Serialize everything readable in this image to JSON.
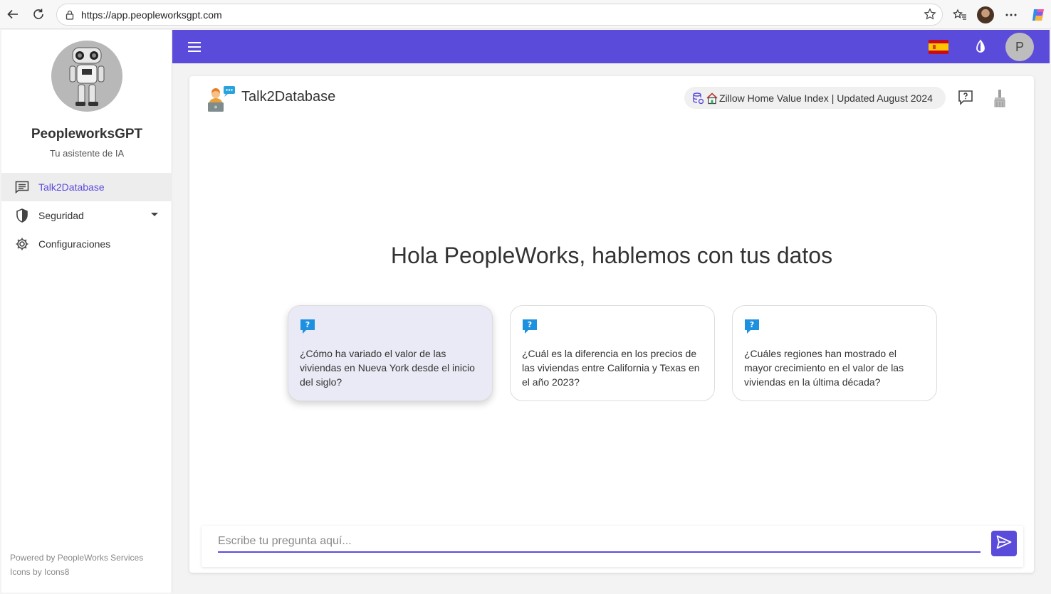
{
  "browser": {
    "url": "https://app.peopleworksgpt.com"
  },
  "sidebar": {
    "app_name": "PeopleworksGPT",
    "subtitle": "Tu asistente de IA",
    "items": [
      {
        "label": "Talk2Database",
        "icon": "chat-icon",
        "active": true
      },
      {
        "label": "Seguridad",
        "icon": "shield-icon",
        "active": false
      },
      {
        "label": "Configuraciones",
        "icon": "gear-icon",
        "active": false
      }
    ],
    "footer": {
      "powered_by": "Powered by PeopleWorks Services",
      "icons_by": "Icons by Icons8"
    }
  },
  "topbar": {
    "accent_color": "#5b4bdb",
    "language_flag": "spain-flag-icon",
    "user_initial": "P"
  },
  "main": {
    "title": "Talk2Database",
    "datasource": "Zillow Home Value Index | Updated August 2024",
    "greeting": "Hola PeopleWorks, hablemos con tus datos",
    "suggestions": [
      "¿Cómo ha variado el valor de las viviendas en Nueva York desde el inicio del siglo?",
      "¿Cuál es la diferencia en los precios de las viviendas entre California y Texas en el año 2023?",
      "¿Cuáles regiones han mostrado el mayor crecimiento en el valor de las viviendas en la última década?"
    ],
    "input_placeholder": "Escribe tu pregunta aquí..."
  }
}
